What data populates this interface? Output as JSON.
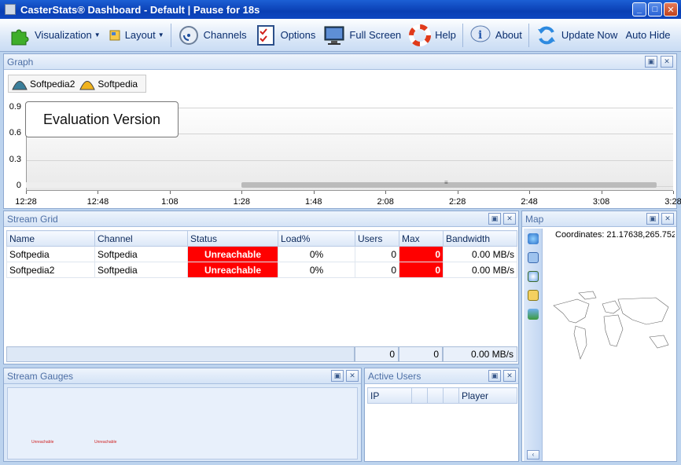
{
  "window": {
    "title": "CasterStats® Dashboard - Default | Pause for 18s"
  },
  "toolbar": {
    "visualization": "Visualization",
    "layout": "Layout",
    "channels": "Channels",
    "options": "Options",
    "full_screen": "Full Screen",
    "help": "Help",
    "about": "About",
    "update_now": "Update Now",
    "auto_hide": "Auto Hide"
  },
  "graph": {
    "title": "Graph",
    "legend": [
      {
        "name": "Softpedia2",
        "color": "#3a7e9a"
      },
      {
        "name": "Softpedia",
        "color": "#f0b21c"
      }
    ],
    "evaluation": "Evaluation Version",
    "scroll_grip": "≡"
  },
  "chart_data": {
    "type": "area",
    "y_ticks": [
      "0.9",
      "0.6",
      "0.3",
      "0"
    ],
    "x_ticks": [
      "12:28",
      "12:48",
      "1:08",
      "1:28",
      "1:48",
      "2:08",
      "2:28",
      "2:48",
      "3:08",
      "3:28"
    ],
    "ylim": [
      0,
      1
    ],
    "series": [
      {
        "name": "Softpedia2",
        "values": []
      },
      {
        "name": "Softpedia",
        "values": []
      }
    ],
    "legend": "top-left",
    "grid": true
  },
  "stream_grid": {
    "title": "Stream Grid",
    "columns": [
      "Name",
      "Channel",
      "Status",
      "Load%",
      "Users",
      "Max",
      "Bandwidth"
    ],
    "rows": [
      {
        "name": "Softpedia",
        "channel": "Softpedia",
        "status": "Unreachable",
        "load": "0%",
        "users": "0",
        "max": "0",
        "bandwidth": "0.00 MB/s"
      },
      {
        "name": "Softpedia2",
        "channel": "Softpedia",
        "status": "Unreachable",
        "load": "0%",
        "users": "0",
        "max": "0",
        "bandwidth": "0.00 MB/s"
      }
    ],
    "totals": {
      "users": "0",
      "max": "0",
      "bandwidth": "0.00 MB/s"
    }
  },
  "map": {
    "title": "Map",
    "coordinates": "Coordinates: 21.17638,265.752"
  },
  "stream_gauges": {
    "title": "Stream Gauges",
    "gauge_status": "Unreachable"
  },
  "active_users": {
    "title": "Active Users",
    "columns": [
      "IP",
      "",
      "",
      "",
      "Player"
    ]
  },
  "colors": {
    "status_bad": "#ff0000",
    "panel_title": "#4d6fa5"
  }
}
